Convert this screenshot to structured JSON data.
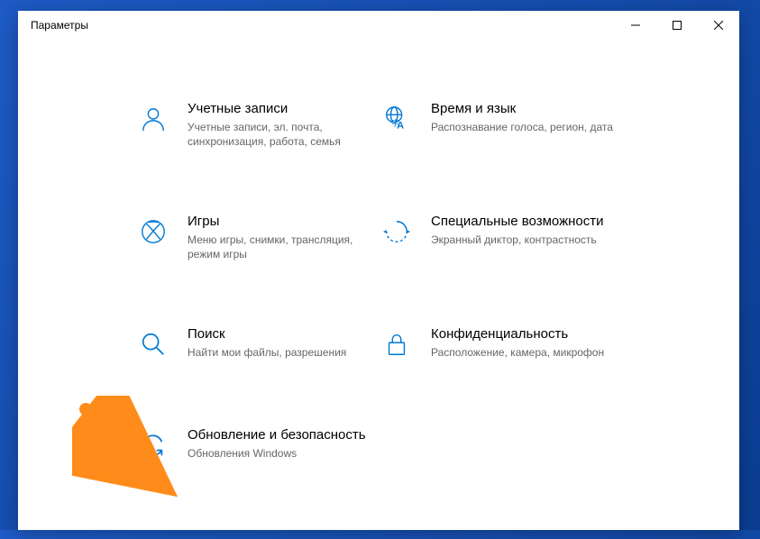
{
  "window": {
    "title": "Параметры"
  },
  "tiles": {
    "accounts": {
      "title": "Учетные записи",
      "desc": "Учетные записи, эл. почта, синхронизация, работа, семья"
    },
    "time": {
      "title": "Время и язык",
      "desc": "Распознавание голоса, регион, дата"
    },
    "gaming": {
      "title": "Игры",
      "desc": "Меню игры, снимки, трансляция, режим игры"
    },
    "ease": {
      "title": "Специальные возможности",
      "desc": "Экранный диктор, контрастность"
    },
    "search": {
      "title": "Поиск",
      "desc": "Найти мои файлы, разрешения"
    },
    "privacy": {
      "title": "Конфиденциальность",
      "desc": "Расположение, камера, микрофон"
    },
    "update": {
      "title": "Обновление и безопасность",
      "desc": "Обновления Windows"
    }
  }
}
